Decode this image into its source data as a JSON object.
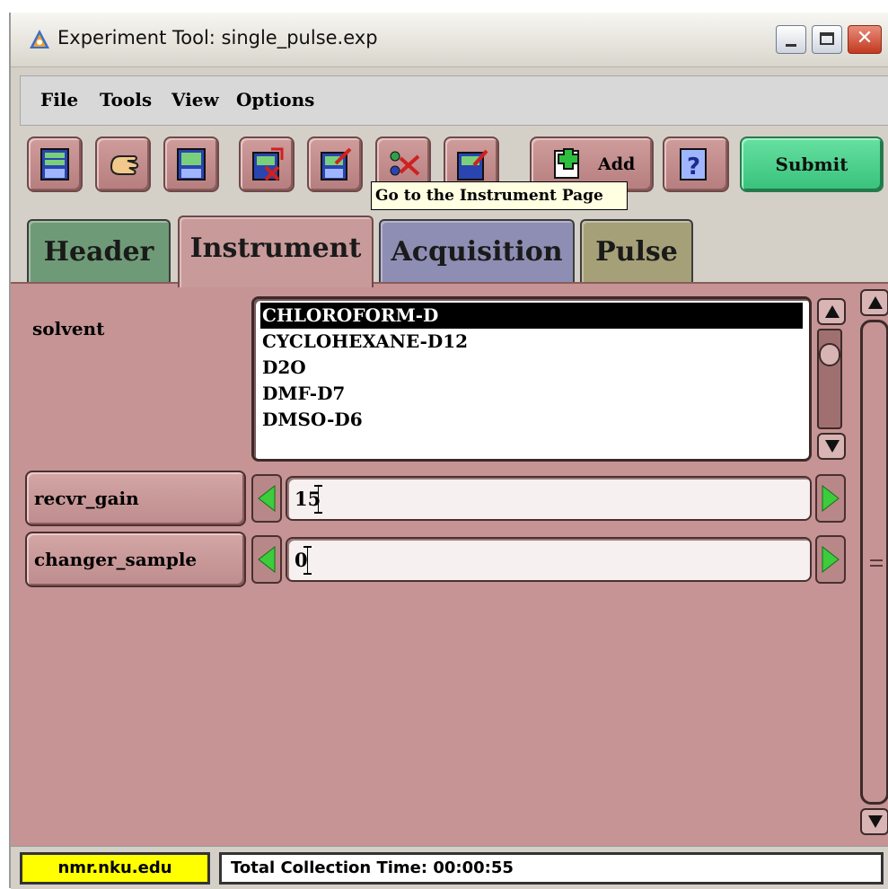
{
  "window": {
    "title": "Experiment Tool: single_pulse.exp",
    "close_glyph": "✕"
  },
  "menu": {
    "items": [
      "File",
      "Tools",
      "View",
      "Options"
    ]
  },
  "toolbar": {
    "buttons": [
      {
        "icon": "database-icon"
      },
      {
        "icon": "hand-icon"
      },
      {
        "icon": "save-icon"
      },
      {
        "icon": "delete-icon"
      },
      {
        "icon": "edit-icon"
      },
      {
        "icon": "instrument-icon"
      },
      {
        "icon": "tool-icon"
      }
    ],
    "add_label": "Add",
    "help_icon": "help-icon",
    "submit_label": "Submit",
    "tooltip": "Go to the Instrument Page"
  },
  "tabs": [
    {
      "label": "Header",
      "color": "#6f9a77"
    },
    {
      "label": "Instrument",
      "color": "#c99a9a",
      "active": true
    },
    {
      "label": "Acquisition",
      "color": "#8e8eb4"
    },
    {
      "label": "Pulse",
      "color": "#a6a078"
    }
  ],
  "instrument": {
    "solvent": {
      "label": "solvent",
      "options": [
        "CHLOROFORM-D",
        "CYCLOHEXANE-D12",
        "D2O",
        "DMF-D7",
        "DMSO-D6"
      ],
      "selected": "CHLOROFORM-D"
    },
    "params": [
      {
        "label": "recvr_gain",
        "value": "15"
      },
      {
        "label": "changer_sample",
        "value": "0"
      }
    ]
  },
  "status": {
    "host": "nmr.nku.edu",
    "text": "Total Collection Time:  00:00:55"
  },
  "colors": {
    "panel": "#c69494",
    "submit": "#38c27c",
    "host_bg": "#ffff00"
  }
}
